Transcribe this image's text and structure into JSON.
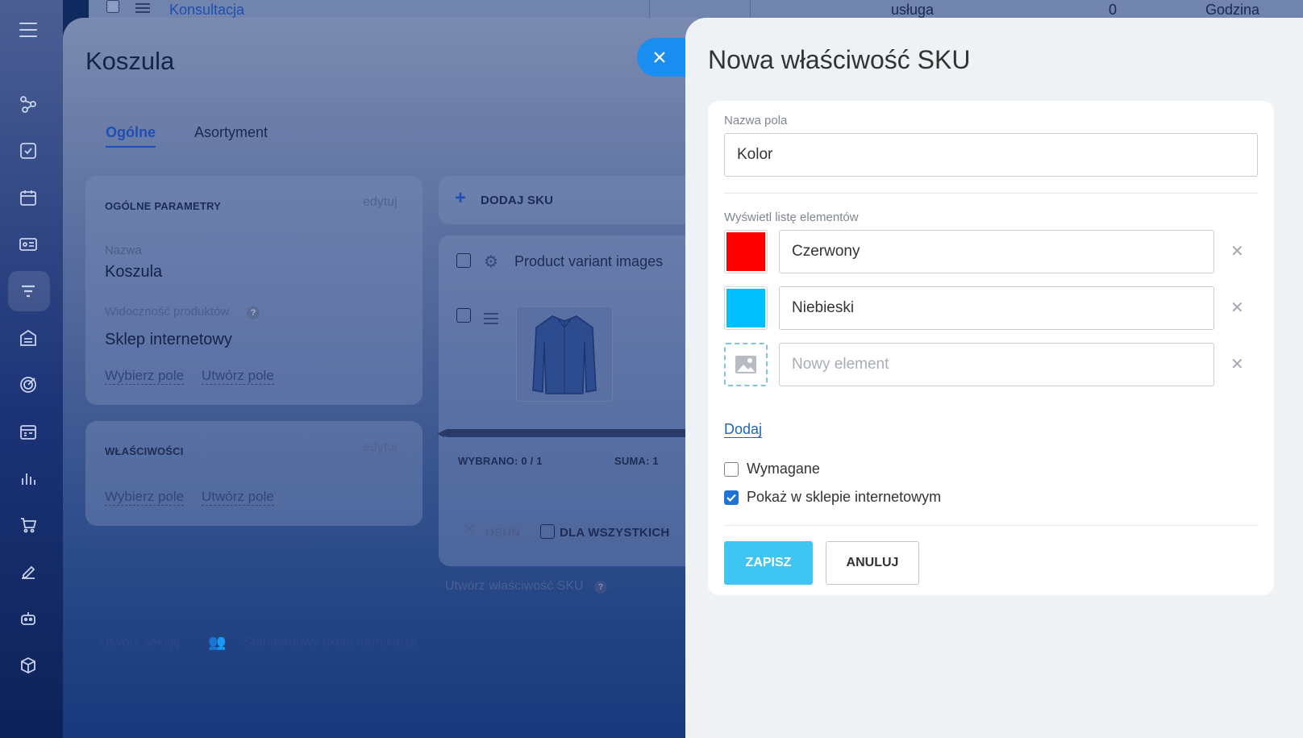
{
  "background_row": {
    "name": "Konsultacja",
    "type": "usługa",
    "quantity": "0",
    "unit": "Godzina"
  },
  "product": {
    "title": "Koszula",
    "tabs": [
      {
        "label": "Ogólne"
      },
      {
        "label": "Asortyment"
      }
    ],
    "general": {
      "header": "OGÓLNE PARAMETRY",
      "edit_label": "edytuj",
      "name_label": "Nazwa",
      "name_value": "Koszula",
      "visibility_label": "Widoczność produktów",
      "visibility_value": "Sklep internetowy",
      "choose_field": "Wybierz pole",
      "create_field": "Utwórz pole"
    },
    "properties": {
      "header": "WŁAŚCIWOŚCI",
      "edit_label": "edytuj",
      "choose_field": "Wybierz pole",
      "create_field": "Utwórz pole"
    },
    "sku": {
      "add_label": "DODAJ SKU",
      "column_images": "Product variant images",
      "selected_label": "WYBRANO: 0 / 1",
      "sum_label": "SUMA: 1",
      "delete_label": "USUŃ",
      "for_all_label": "DLA WSZYSTKICH",
      "create_sku_property": "Utwórz właściwość SKU"
    },
    "footer": {
      "create_section": "Utwórz sekcję",
      "standard_layout": "Standardowy układ formularza"
    }
  },
  "slider": {
    "title": "Nowa właściwość SKU",
    "field_name_label": "Nazwa pola",
    "field_name_value": "Kolor",
    "list_label": "Wyświetl listę elementów",
    "items": [
      {
        "value": "Czerwony",
        "color": "#ff0000"
      },
      {
        "value": "Niebieski",
        "color": "#00bfff"
      }
    ],
    "new_item_placeholder": "Nowy element",
    "add_label": "Dodaj",
    "required_label": "Wymagane",
    "required_checked": false,
    "show_in_store_label": "Pokaż w sklepie internetowym",
    "show_in_store_checked": true,
    "save_label": "ZAPISZ",
    "cancel_label": "ANULUJ"
  },
  "colors": {
    "accent": "#3ec5f1",
    "link": "#2067b0",
    "close_button": "#1a8ef0"
  }
}
